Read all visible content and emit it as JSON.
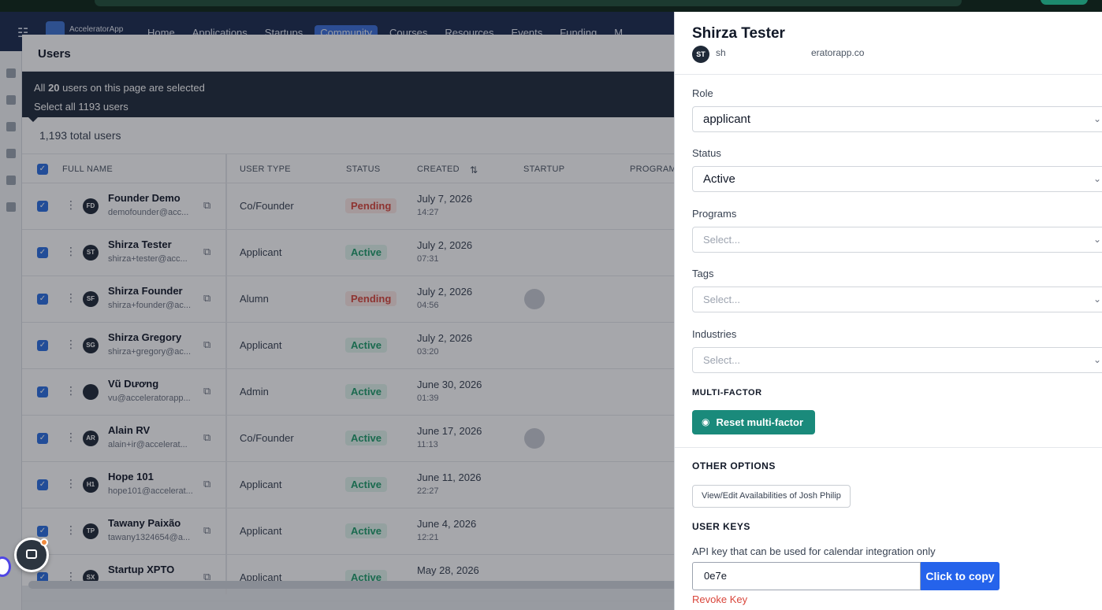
{
  "app": {
    "brand": "AcceleratorApp",
    "nav": [
      "Home",
      "Applications",
      "Startups",
      "Community",
      "Courses",
      "Resources",
      "Events",
      "Funding",
      "M"
    ],
    "active_nav": "Community"
  },
  "users_modal": {
    "title": "Users",
    "selection": {
      "line1_prefix": "All ",
      "line1_count": "20",
      "line1_suffix": " users on this page are selected",
      "line2": "Select all 1193 users"
    },
    "total": "1,193 total users",
    "columns": [
      "FULL NAME",
      "USER TYPE",
      "STATUS",
      "CREATED",
      "STARTUP",
      "PROGRAM"
    ],
    "rows": [
      {
        "initials": "FD",
        "name": "Founder Demo",
        "email": "demofounder@acc...",
        "type": "Co/Founder",
        "status": "Pending",
        "date": "July 7, 2026",
        "time": "14:27",
        "startup": false
      },
      {
        "initials": "ST",
        "name": "Shirza Tester",
        "email": "shirza+tester@acc...",
        "type": "Applicant",
        "status": "Active",
        "date": "July 2, 2026",
        "time": "07:31",
        "startup": false
      },
      {
        "initials": "SF",
        "name": "Shirza Founder",
        "email": "shirza+founder@ac...",
        "type": "Alumn",
        "status": "Pending",
        "date": "July 2, 2026",
        "time": "04:56",
        "startup": true
      },
      {
        "initials": "SG",
        "name": "Shirza Gregory",
        "email": "shirza+gregory@ac...",
        "type": "Applicant",
        "status": "Active",
        "date": "July 2, 2026",
        "time": "03:20",
        "startup": false
      },
      {
        "initials": "",
        "name": "Vũ Dương",
        "email": "vu@acceleratorapp...",
        "type": "Admin",
        "status": "Active",
        "date": "June 30, 2026",
        "time": "01:39",
        "startup": false
      },
      {
        "initials": "AR",
        "name": "Alain RV",
        "email": "alain+ir@accelerat...",
        "type": "Co/Founder",
        "status": "Active",
        "date": "June 17, 2026",
        "time": "11:13",
        "startup": true
      },
      {
        "initials": "H1",
        "name": "Hope 101",
        "email": "hope101@accelerat...",
        "type": "Applicant",
        "status": "Active",
        "date": "June 11, 2026",
        "time": "22:27",
        "startup": false
      },
      {
        "initials": "TP",
        "name": "Tawany Paixão",
        "email": "tawany1324654@a...",
        "type": "Applicant",
        "status": "Active",
        "date": "June 4, 2026",
        "time": "12:21",
        "startup": false
      },
      {
        "initials": "SX",
        "name": "Startup XPTO",
        "email": "",
        "type": "Applicant",
        "status": "Active",
        "date": "May 28, 2026",
        "time": "",
        "startup": false
      }
    ]
  },
  "drawer": {
    "name": "Shirza Tester",
    "initials": "ST",
    "email_start": "sh",
    "email_end": "eratorapp.co",
    "role_label": "Role",
    "role_value": "applicant",
    "status_label": "Status",
    "status_value": "Active",
    "programs_label": "Programs",
    "programs_placeholder": "Select...",
    "tags_label": "Tags",
    "tags_placeholder": "Select...",
    "industries_label": "Industries",
    "industries_placeholder": "Select...",
    "mfa_heading": "MULTI-FACTOR",
    "mfa_button": "Reset multi-factor",
    "other_heading": "OTHER OPTIONS",
    "avail_button": "View/Edit Availabilities of Josh Philip",
    "keys_heading": "USER KEYS",
    "api_label": "API key that can be used for calendar integration only",
    "api_value": "0e7e",
    "copy_button": "Click to copy",
    "revoke": "Revoke Key"
  }
}
